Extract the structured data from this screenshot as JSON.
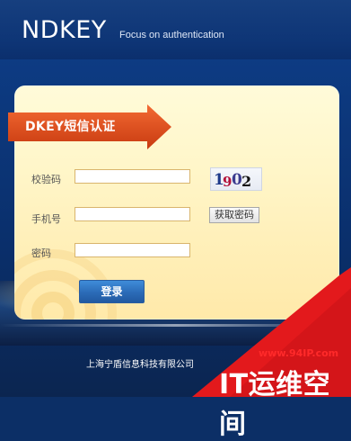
{
  "header": {
    "brand": "NDKEY",
    "tagline": "Focus on authentication"
  },
  "card": {
    "title": "DKEY短信认证"
  },
  "form": {
    "captcha_label": "校验码",
    "phone_label": "手机号",
    "password_label": "密码",
    "captcha_value": "",
    "phone_value": "",
    "password_value": "",
    "captcha_image_text": "1902",
    "get_password_label": "获取密码",
    "login_label": "登录"
  },
  "footer": {
    "company": "上海宁盾信息科技有限公司"
  },
  "watermark": {
    "url": "www.94IP.com",
    "text": "IT运维空间"
  },
  "colors": {
    "title_arrow": "#e24a16",
    "banner_red": "#e3191c",
    "input_border": "#d9b56d",
    "login_button": "#2b6bb7"
  }
}
